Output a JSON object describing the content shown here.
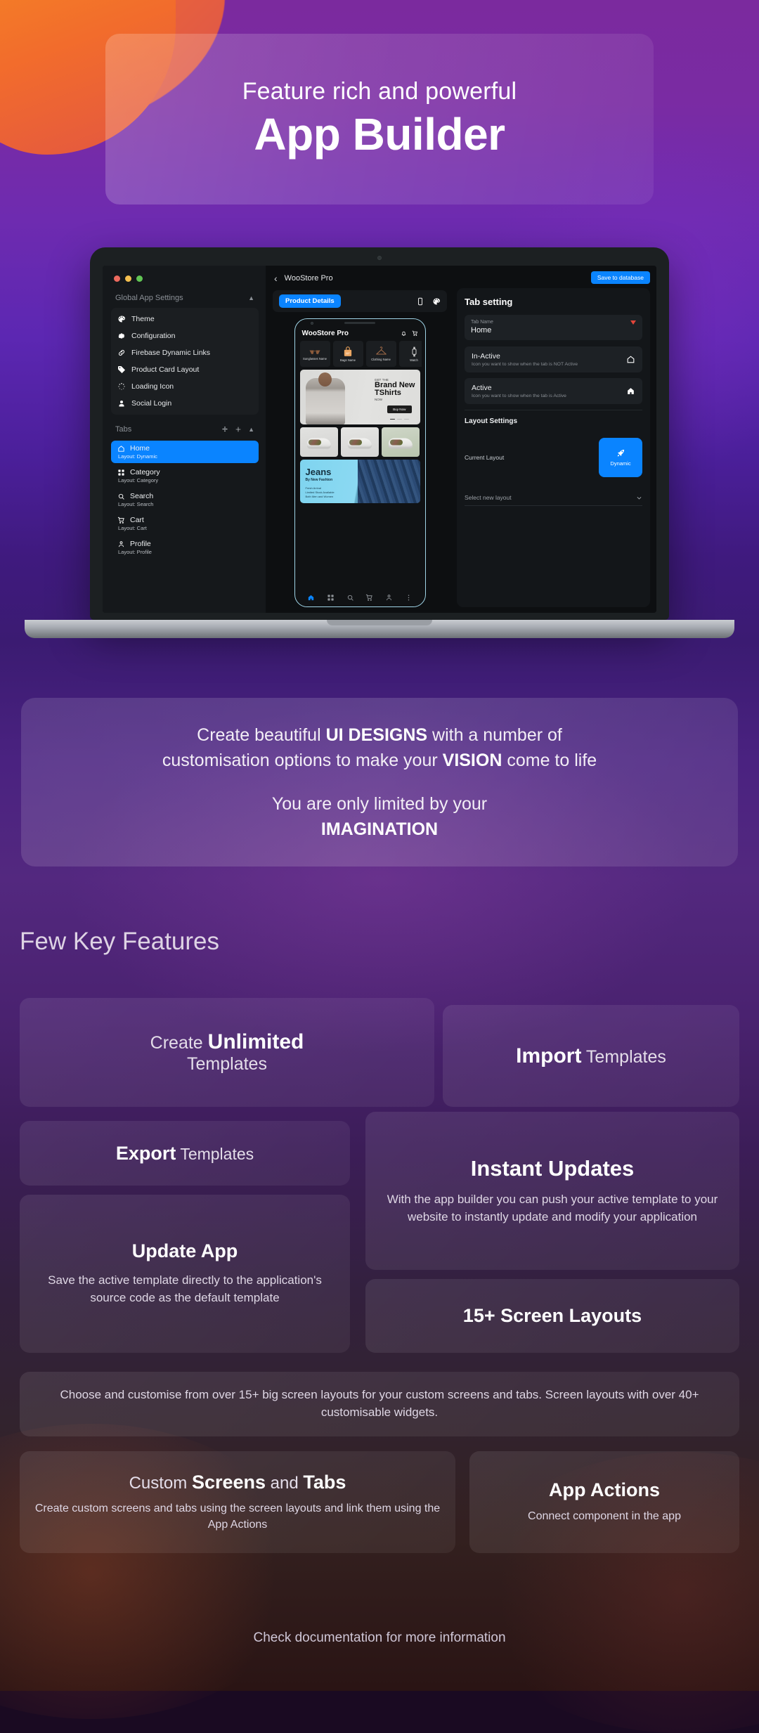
{
  "hero": {
    "subtitle": "Feature rich and powerful",
    "title": "App Builder"
  },
  "builder": {
    "window_controls": [
      "close",
      "minimize",
      "maximize"
    ],
    "sidebar": {
      "section_title": "Global App Settings",
      "items": [
        {
          "label": "Theme",
          "icon": "palette-icon"
        },
        {
          "label": "Configuration",
          "icon": "gear-icon"
        },
        {
          "label": "Firebase Dynamic Links",
          "icon": "link-icon"
        },
        {
          "label": "Product Card Layout",
          "icon": "tag-icon"
        },
        {
          "label": "Loading Icon",
          "icon": "spinner-icon"
        },
        {
          "label": "Social Login",
          "icon": "user-icon"
        }
      ],
      "tabs_title": "Tabs",
      "tabs_tools": [
        "move-icon",
        "plus-icon",
        "chevron-up-icon"
      ],
      "tabs": [
        {
          "name": "Home",
          "layout": "Layout: Dynamic",
          "icon": "home-icon",
          "active": true
        },
        {
          "name": "Category",
          "layout": "Layout: Category",
          "icon": "grid-icon",
          "active": false
        },
        {
          "name": "Search",
          "layout": "Layout: Search",
          "icon": "search-icon",
          "active": false
        },
        {
          "name": "Cart",
          "layout": "Layout: Cart",
          "icon": "cart-icon",
          "active": false
        },
        {
          "name": "Profile",
          "layout": "Layout: Profile",
          "icon": "person-icon",
          "active": false
        }
      ]
    },
    "center": {
      "back_icon": "chevron-left-icon",
      "app_title": "WooStore Pro",
      "preview_pill": "Product Details",
      "preview_icons": [
        "phone-icon",
        "palette-icon"
      ]
    },
    "phone": {
      "title": "WooStore Pro",
      "header_icons": [
        "notification-icon",
        "cart-icon"
      ],
      "categories": [
        "Sunglasses Name",
        "Bags Name",
        "Clothing Name",
        "Watch"
      ],
      "banner": {
        "pre": "GET THE",
        "title": "Brand New",
        "title2": "TShirts",
        "sub": "NOW",
        "button": "Buy Now"
      },
      "jeans": {
        "title": "Jeans",
        "subtitle": "By New Fashion",
        "bullets": [
          "Fresh Arrival",
          "Limited Stock Available",
          "Both Men and Women"
        ]
      },
      "nav_icons": [
        "home-icon",
        "grid-icon",
        "search-icon",
        "cart-icon",
        "person-icon",
        "more-icon"
      ]
    },
    "right_panel": {
      "save_button": "Save to database",
      "heading": "Tab setting",
      "tab_name_label": "Tab Name",
      "tab_name_value": "Home",
      "inactive": {
        "title": "In-Active",
        "desc": "Icon you want to show when the tab is NOT Active",
        "icon": "home-outline-icon"
      },
      "active": {
        "title": "Active",
        "desc": "Icon you want to show when the tab is Active",
        "icon": "home-filled-icon"
      },
      "layout_settings_title": "Layout Settings",
      "current_layout_label": "Current Layout",
      "current_layout_value": "Dynamic",
      "current_layout_icon": "rocket-icon",
      "select_new_layout_label": "Select new layout",
      "select_caret": "chevron-down-icon"
    }
  },
  "description": {
    "line1_a": "Create beautiful ",
    "line1_b": "UI DESIGNS",
    "line1_c": " with a number of",
    "line2_a": "customisation options to make your ",
    "line2_b": "VISION",
    "line2_c": " come to life",
    "line3": "You are only limited by your",
    "line4": "IMAGINATION"
  },
  "features_heading": "Few Key Features",
  "cards": [
    {
      "id": "unlimited-templates",
      "pre": "Create ",
      "strong": "Unlimited",
      "post": "Templates"
    },
    {
      "id": "import-templates",
      "strong": "Import",
      "post": " Templates"
    },
    {
      "id": "export-templates",
      "strong": "Export",
      "post": " Templates"
    },
    {
      "id": "instant-updates",
      "title": "Instant Updates",
      "body": "With the app builder you can push your active template to your website to instantly update and modify your application"
    },
    {
      "id": "update-app",
      "title": "Update App",
      "body": "Save the active template directly to the application's source code as the default template"
    },
    {
      "id": "screen-layouts",
      "title": "15+ Screen Layouts"
    },
    {
      "id": "screen-layouts-desc",
      "body": "Choose and customise from over 15+ big screen layouts for your custom screens and tabs. Screen layouts with over 40+ customisable widgets."
    },
    {
      "id": "custom-screens-tabs",
      "pre": "Custom ",
      "strong": "Screens",
      "mid": " and ",
      "strong2": "Tabs",
      "body": "Create custom screens and tabs using the screen layouts and link them using the App Actions"
    },
    {
      "id": "app-actions",
      "title": "App Actions",
      "body": "Connect component in the app"
    }
  ],
  "footnote": "Check documentation for more information",
  "colors": {
    "accent_blue": "#0a84ff",
    "orange": "#f47b2a",
    "purple": "#5c27b2",
    "card_bg": "rgba(255,255,255,0.08)"
  }
}
